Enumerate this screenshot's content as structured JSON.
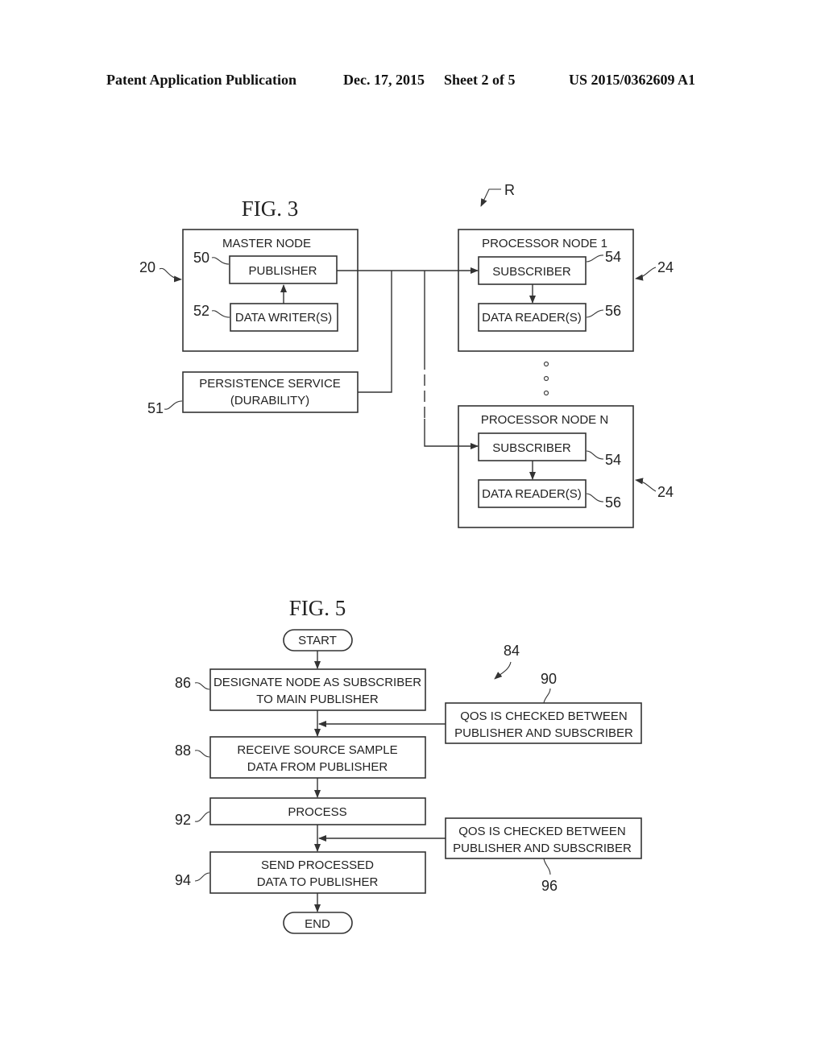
{
  "header": {
    "publication": "Patent Application Publication",
    "date": "Dec. 17, 2015",
    "sheet": "Sheet 2 of 5",
    "number": "US 2015/0362609 A1"
  },
  "fig3": {
    "title": "FIG. 3",
    "ref_r": "R",
    "master": {
      "label": "MASTER NODE",
      "ref": "20",
      "publisher": "PUBLISHER",
      "publisher_ref": "50",
      "writers": "DATA WRITER(S)",
      "writers_ref": "52"
    },
    "persistence": {
      "line1": "PERSISTENCE SERVICE",
      "line2": "(DURABILITY)",
      "ref": "51"
    },
    "node1": {
      "label": "PROCESSOR NODE 1",
      "ref": "24",
      "subscriber": "SUBSCRIBER",
      "subscriber_ref": "54",
      "readers": "DATA READER(S)",
      "readers_ref": "56"
    },
    "nodeN": {
      "label": "PROCESSOR NODE N",
      "ref": "24",
      "subscriber": "SUBSCRIBER",
      "subscriber_ref": "54",
      "readers": "DATA READER(S)",
      "readers_ref": "56"
    }
  },
  "fig5": {
    "title": "FIG. 5",
    "ref_84": "84",
    "start": "START",
    "end": "END",
    "steps": [
      {
        "ref": "86",
        "line1": "DESIGNATE NODE AS SUBSCRIBER",
        "line2": "TO MAIN PUBLISHER"
      },
      {
        "ref": "88",
        "line1": "RECEIVE SOURCE SAMPLE",
        "line2": "DATA FROM PUBLISHER"
      },
      {
        "ref": "92",
        "line1": "PROCESS",
        "line2": ""
      },
      {
        "ref": "94",
        "line1": "SEND PROCESSED",
        "line2": "DATA TO PUBLISHER"
      }
    ],
    "qos": [
      {
        "ref": "90",
        "line1": "QOS IS CHECKED BETWEEN",
        "line2": "PUBLISHER AND SUBSCRIBER"
      },
      {
        "ref": "96",
        "line1": "QOS IS CHECKED BETWEEN",
        "line2": "PUBLISHER AND SUBSCRIBER"
      }
    ]
  }
}
